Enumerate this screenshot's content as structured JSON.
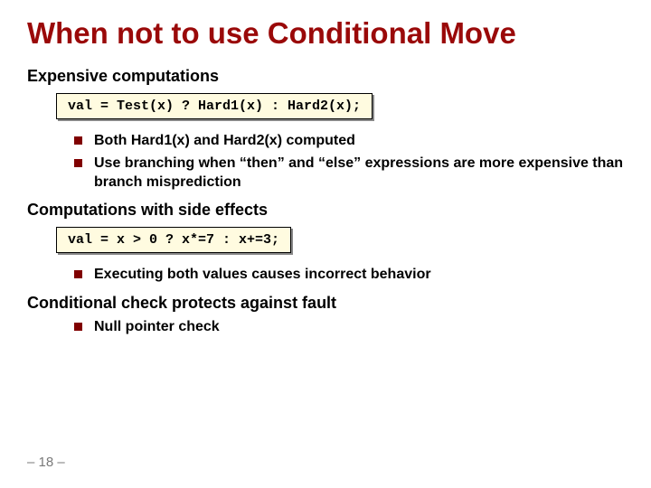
{
  "title": "When not to use Conditional Move",
  "section1": {
    "heading": "Expensive computations",
    "code": "val = Test(x) ? Hard1(x) : Hard2(x);",
    "bullets": [
      "Both Hard1(x) and Hard2(x) computed",
      "Use branching when “then” and “else” expressions are more expensive than branch misprediction"
    ]
  },
  "section2": {
    "heading": "Computations with side effects",
    "code": "val = x > 0 ? x*=7 : x+=3;",
    "bullets": [
      "Executing both values causes incorrect behavior"
    ]
  },
  "section3": {
    "heading": "Conditional check protects against fault",
    "bullets": [
      "Null pointer check"
    ]
  },
  "page_number": "– 18 –"
}
